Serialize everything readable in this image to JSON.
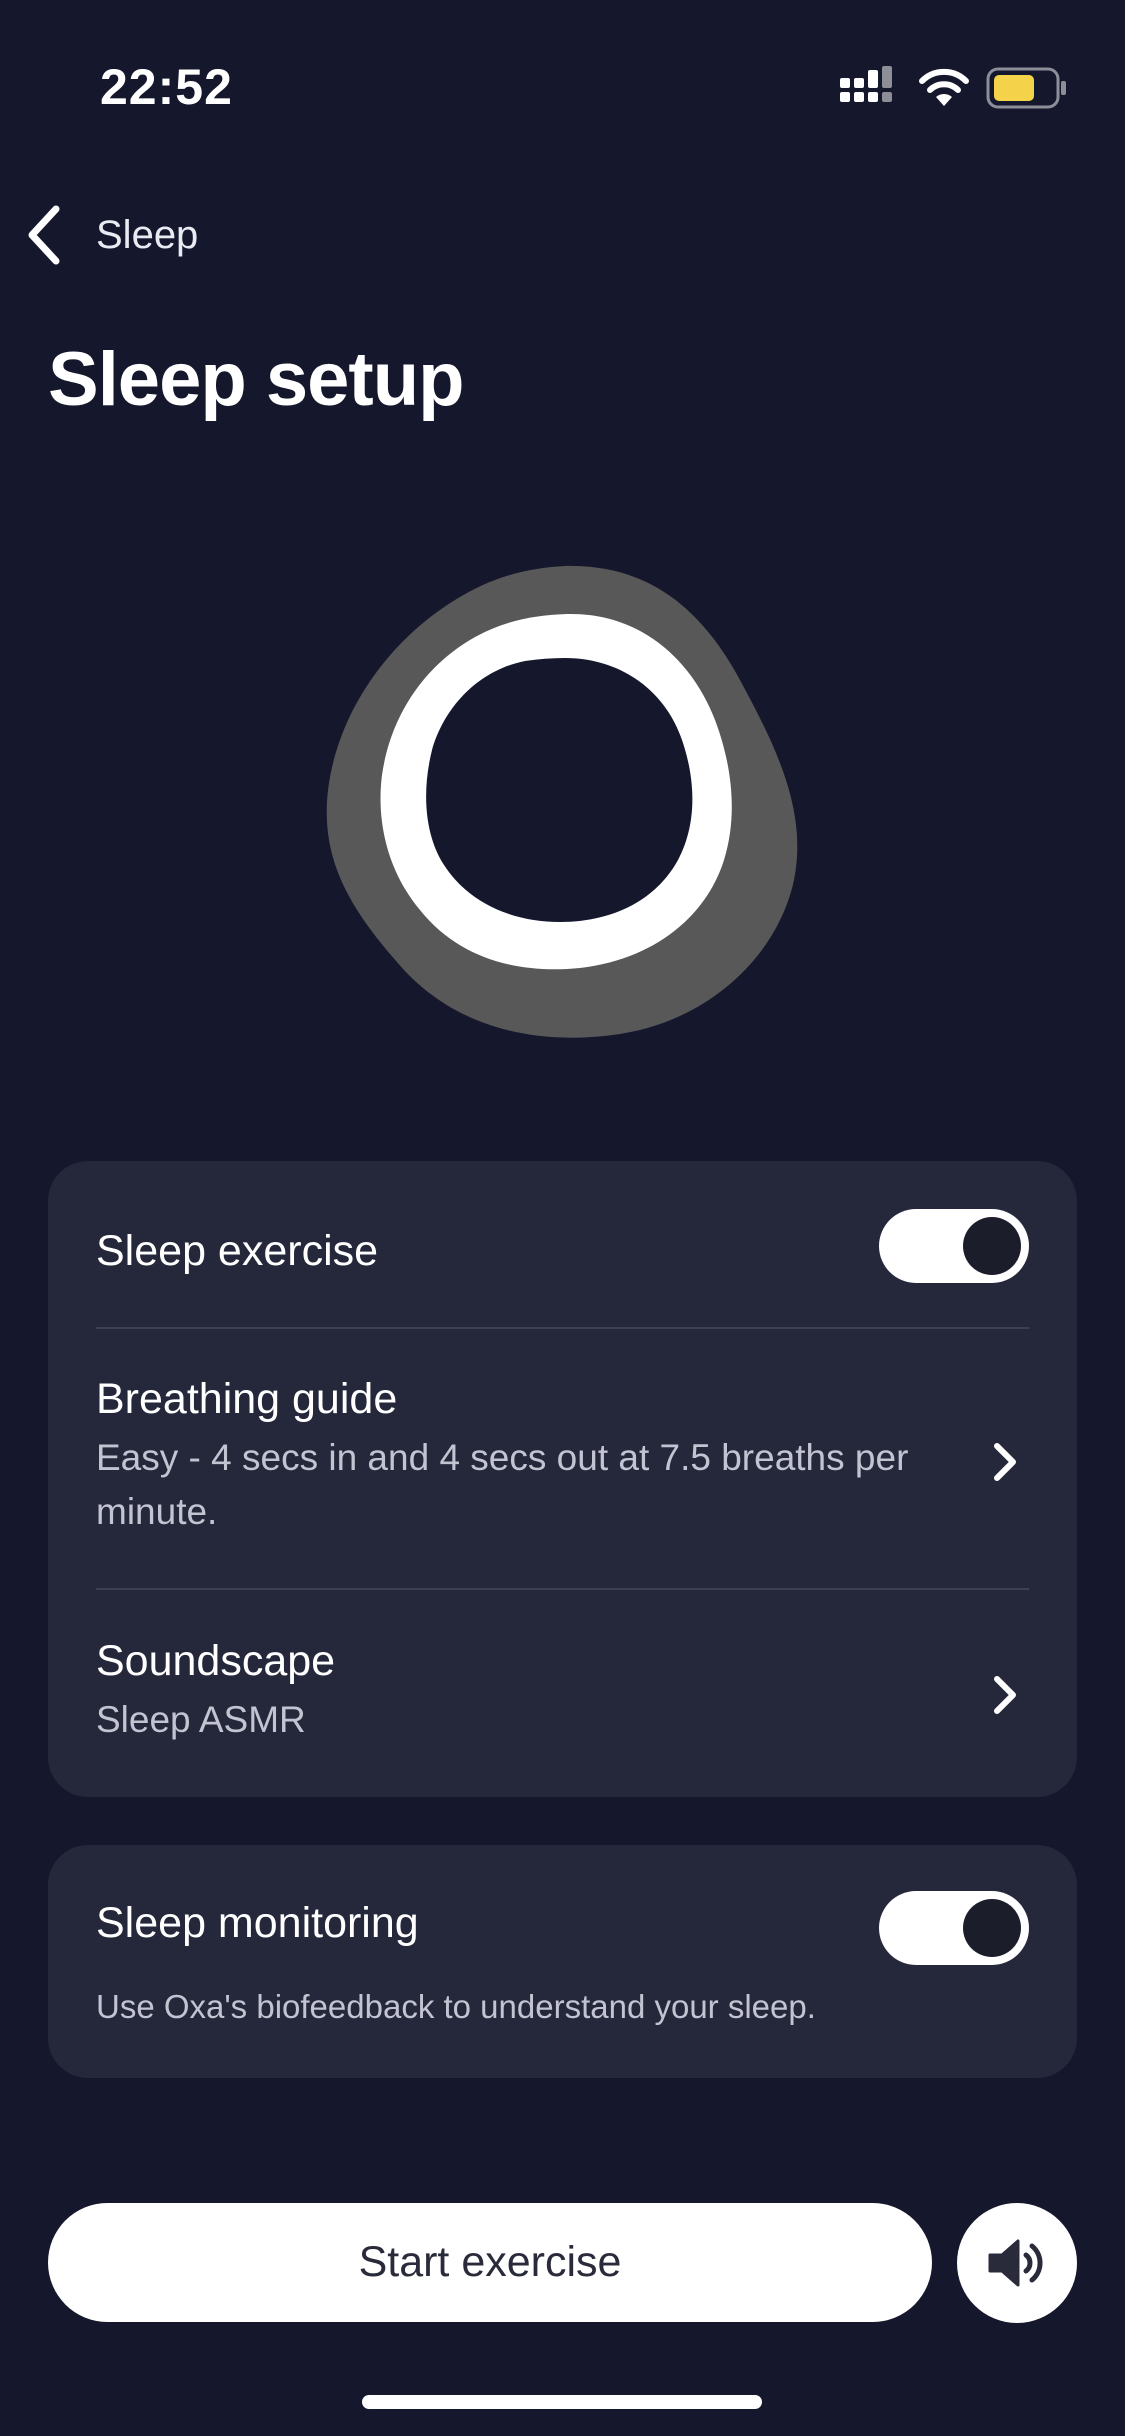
{
  "status_bar": {
    "time": "22:52",
    "signal_icon": "cellular-signal-icon",
    "wifi_icon": "wifi-icon",
    "battery_icon": "battery-icon",
    "battery_color": "#f4d34a"
  },
  "nav": {
    "back_label": "Sleep",
    "back_icon": "chevron-left-icon"
  },
  "page": {
    "title": "Sleep setup"
  },
  "exercise_card": {
    "sleep_exercise": {
      "label": "Sleep exercise",
      "enabled": true
    },
    "breathing_guide": {
      "title": "Breathing guide",
      "subtitle": "Easy - 4 secs in and 4 secs out at 7.5 breaths per minute."
    },
    "soundscape": {
      "title": "Soundscape",
      "subtitle": "Sleep ASMR"
    }
  },
  "monitoring_card": {
    "label": "Sleep monitoring",
    "enabled": true,
    "description": "Use Oxa's biofeedback to understand your sleep."
  },
  "actions": {
    "start_label": "Start exercise",
    "sound_icon": "speaker-icon"
  },
  "colors": {
    "background": "#15172d",
    "card": "#25273b",
    "ring_outer": "#585858",
    "ring_inner": "#ffffff"
  }
}
